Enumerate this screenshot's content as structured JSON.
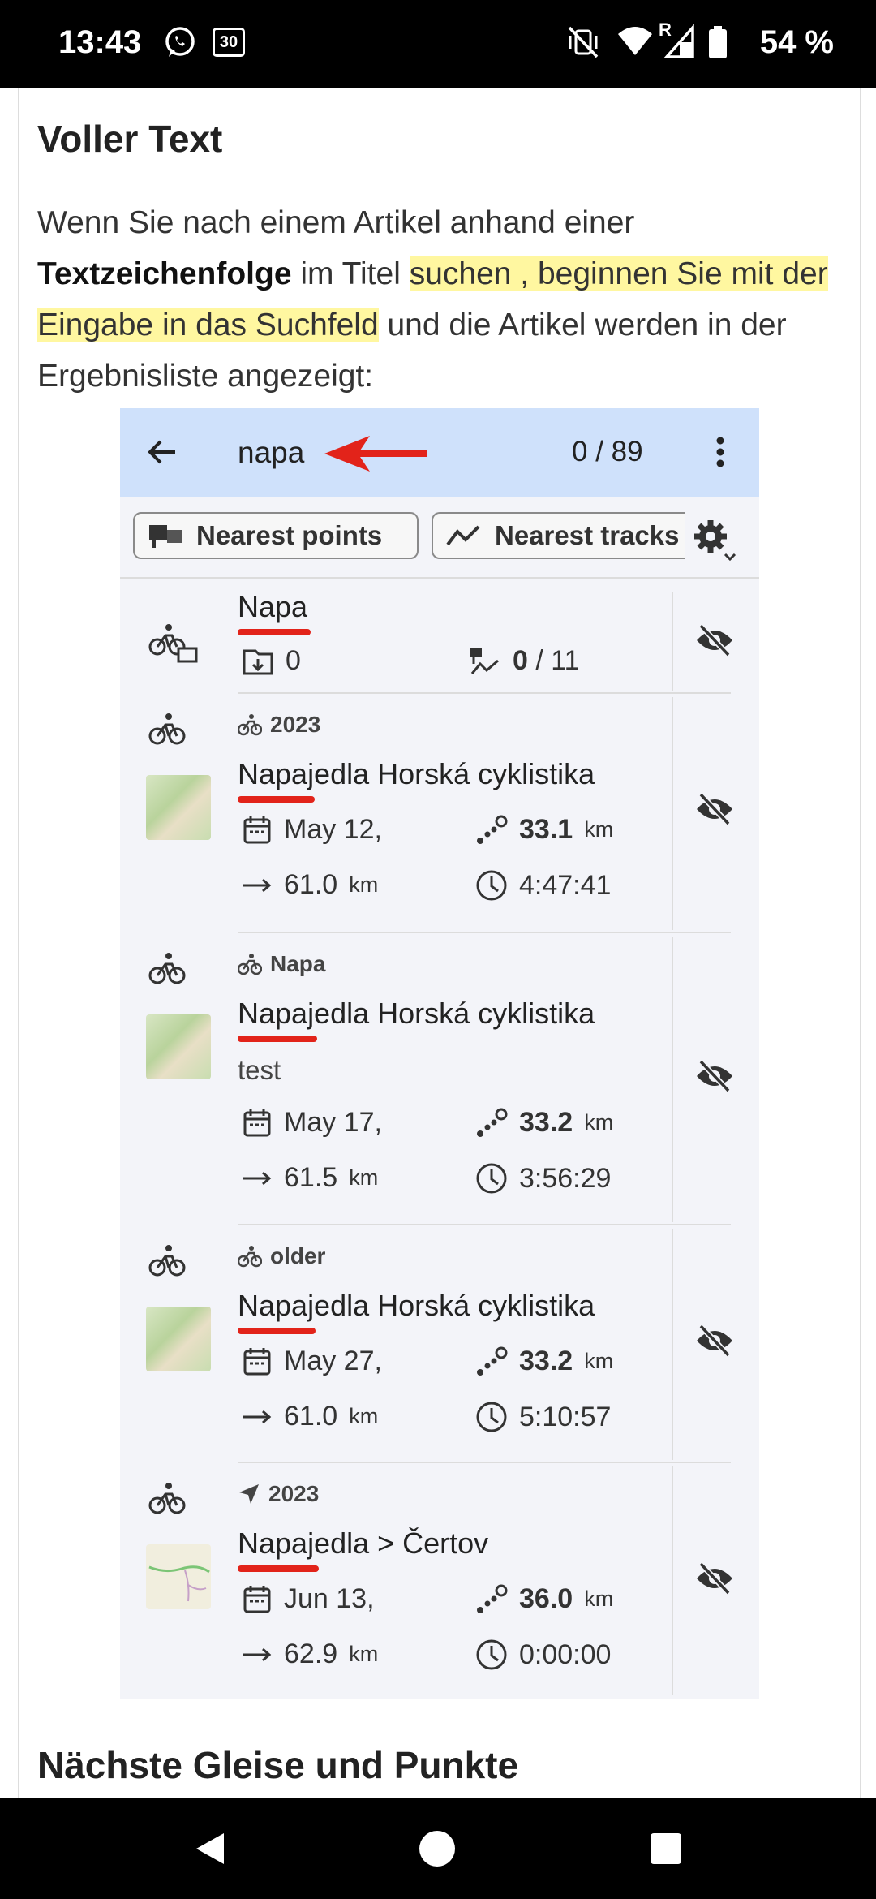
{
  "status_bar": {
    "time": "13:43",
    "calendar_badge": "30",
    "roaming": "R",
    "battery": "54 %"
  },
  "article": {
    "heading": "Voller Text",
    "para_1": "Wenn Sie nach einem Artikel anhand einer",
    "para_bold": "Textzeichenfolge",
    "para_2": " im Titel ",
    "para_highlight": "suchen , beginnen Sie mit der Eingabe in das Suchfeld",
    "para_3": " und die Artikel werden in der Ergebnisliste angezeigt:",
    "next_heading": "Nächste Gleise und Punkte"
  },
  "screenshot": {
    "search_query": "napa",
    "result_count": "0 / 89",
    "chips": [
      "Nearest points",
      "Nearest tracks"
    ],
    "folder_row": {
      "title": "Napa",
      "items_count": "0",
      "tracks_visible": "0",
      "tracks_total": " / 11"
    },
    "tracks": [
      {
        "category": "2023",
        "title": "Napajedla Horská cyklistika",
        "date": "May 12,",
        "distance": "33.1",
        "distance_unit": "km",
        "length": "61.0",
        "length_unit": "km",
        "duration": "4:47:41"
      },
      {
        "category": "Napa",
        "title": "Napajedla Horská cyklistika",
        "description": "test",
        "date": "May 17,",
        "distance": "33.2",
        "distance_unit": "km",
        "length": "61.5",
        "length_unit": "km",
        "duration": "3:56:29"
      },
      {
        "category": "older",
        "title": "Napajedla Horská cyklistika",
        "date": "May 27,",
        "distance": "33.2",
        "distance_unit": "km",
        "length": "61.0",
        "length_unit": "km",
        "duration": "5:10:57"
      },
      {
        "category": "2023",
        "title": "Napajedla > Čertov",
        "date": "Jun 13,",
        "distance": "36.0",
        "distance_unit": "km",
        "length": "62.9",
        "length_unit": "km",
        "duration": "0:00:00"
      }
    ]
  },
  "colors": {
    "accent_underline": "#e2231a",
    "highlight": "#fff7a0",
    "app_bar": "#cfe1fb"
  }
}
